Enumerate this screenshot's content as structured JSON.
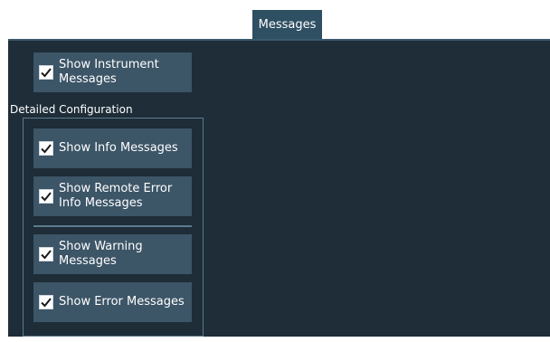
{
  "tab": {
    "label": "Messages"
  },
  "show_instrument": {
    "label": "Show Instrument Messages",
    "checked": true
  },
  "detailed": {
    "title": "Detailed Configuration",
    "items": [
      {
        "label": "Show Info Messages",
        "checked": true
      },
      {
        "label": "Show Remote Error Info Messages",
        "checked": true
      },
      {
        "label": "Show Warning Messages",
        "checked": true
      },
      {
        "label": "Show Error Messages",
        "checked": true
      }
    ]
  },
  "colors": {
    "panel_bg": "#1e2d38",
    "tab_bg": "#2f4f63",
    "button_bg": "#3c5567",
    "frame_line": "#5c7b8e"
  },
  "icons": {
    "checkbox": "check-icon"
  }
}
